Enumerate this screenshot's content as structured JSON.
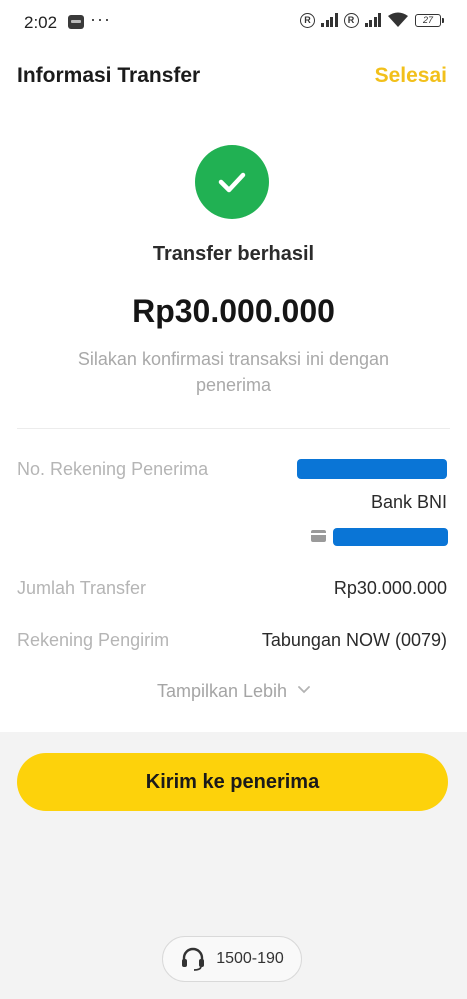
{
  "status_bar": {
    "time": "2:02",
    "dots": "···",
    "reg_label": "R",
    "battery": "27"
  },
  "header": {
    "title": "Informasi Transfer",
    "done_label": "Selesai"
  },
  "result": {
    "title": "Transfer berhasil",
    "amount": "Rp30.000.000",
    "subtitle": "Silakan konfirmasi transaksi ini dengan penerima"
  },
  "details": {
    "recipient_label": "No. Rekening Penerima",
    "recipient_bank": "Bank BNI",
    "amount_label": "Jumlah Transfer",
    "amount_value": "Rp30.000.000",
    "sender_label": "Rekening Pengirim",
    "sender_value": "Tabungan NOW (0079)"
  },
  "show_more_label": "Tampilkan Lebih",
  "cta_label": "Kirim ke penerima",
  "help_number": "1500-190",
  "colors": {
    "accent_yellow": "#fdd20b",
    "success_green": "#21b153",
    "link_yellow": "#f2c01b"
  }
}
